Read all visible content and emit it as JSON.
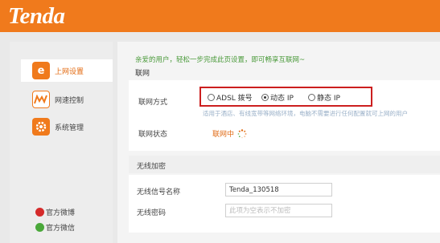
{
  "brand": {
    "logo_text": "Tenda",
    "header_color": "#f07a1c"
  },
  "sidebar": {
    "items": [
      {
        "label": "上网设置",
        "icon": "internet-e-icon",
        "active": true,
        "color": "#f07a1c"
      },
      {
        "label": "网速控制",
        "icon": "speed-wave-icon",
        "active": false,
        "color": "#f07a1c"
      },
      {
        "label": "系统管理",
        "icon": "gear-icon",
        "active": false,
        "color": "#f07a1c"
      }
    ],
    "social": [
      {
        "label": "官方微博",
        "icon": "weibo-icon",
        "color": "#d52b2b"
      },
      {
        "label": "官方微信",
        "icon": "wechat-icon",
        "color": "#4aa83a"
      }
    ]
  },
  "main": {
    "intro_text": "亲爱的用户，轻松一步完成此页设置，即可畅享互联网~",
    "section_connect": {
      "title": "联网",
      "mode_label": "联网方式",
      "options": [
        {
          "label": "ADSL 拨号",
          "selected": false
        },
        {
          "label": "动态 IP",
          "selected": true
        },
        {
          "label": "静态 IP",
          "selected": false
        }
      ],
      "hint": "适用于酒店、有线宽带等网络环境，电脑不需要进行任何配置就可上网的用户",
      "status_label": "联网状态",
      "status_value": "联网中"
    },
    "section_wireless": {
      "title": "无线加密",
      "ssid_label": "无线信号名称",
      "ssid_value": "Tenda_130518",
      "password_label": "无线密码",
      "password_placeholder": "此项为空表示不加密"
    }
  }
}
